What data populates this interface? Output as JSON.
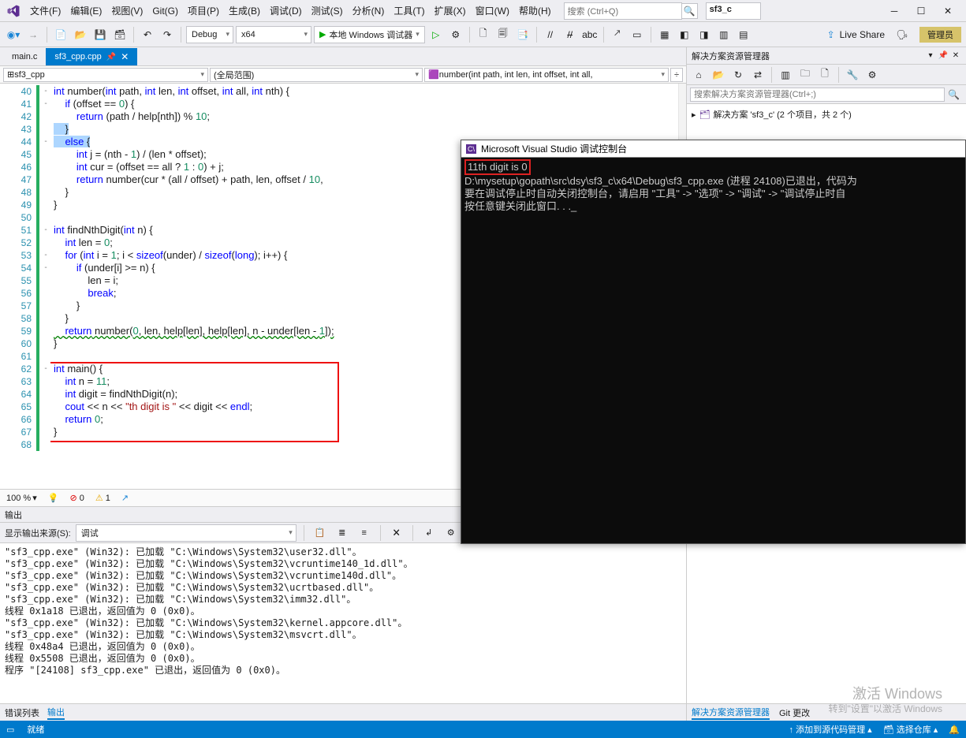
{
  "menubar": {
    "items": [
      "文件(F)",
      "编辑(E)",
      "视图(V)",
      "Git(G)",
      "项目(P)",
      "生成(B)",
      "调试(D)",
      "测试(S)",
      "分析(N)",
      "工具(T)",
      "扩展(X)",
      "窗口(W)",
      "帮助(H)"
    ],
    "search_placeholder": "搜索 (Ctrl+Q)",
    "project_name": "sf3_c"
  },
  "toolbar": {
    "config": "Debug",
    "platform": "x64",
    "run_label": "本地 Windows 调试器",
    "live_share": "Live Share",
    "admin": "管理员"
  },
  "tabs": [
    {
      "label": "main.c",
      "active": false
    },
    {
      "label": "sf3_cpp.cpp",
      "active": true
    }
  ],
  "nav": {
    "scope": "sf3_cpp",
    "scope2": "(全局范围)",
    "member": "number(int path, int len, int offset, int all,"
  },
  "code": {
    "first_line": 40,
    "lines": [
      {
        "n": 40,
        "fold": "-",
        "t": "int number(int path, int len, int offset, int all, int nth) {"
      },
      {
        "n": 41,
        "fold": "-",
        "t": "    if (offset == 0) {"
      },
      {
        "n": 42,
        "t": "        return (path / help[nth]) % 10;"
      },
      {
        "n": 43,
        "t": "    }",
        "sel": true,
        "selText": "    }"
      },
      {
        "n": 44,
        "fold": "-",
        "t": "    else {",
        "sel": true,
        "selText": "    else {"
      },
      {
        "n": 45,
        "t": "        int j = (nth - 1) / (len * offset);"
      },
      {
        "n": 46,
        "t": "        int cur = (offset == all ? 1 : 0) + j;"
      },
      {
        "n": 47,
        "t": "        return number(cur * (all / offset) + path, len, offset / 10,"
      },
      {
        "n": 48,
        "t": "    }"
      },
      {
        "n": 49,
        "t": "}"
      },
      {
        "n": 50,
        "t": ""
      },
      {
        "n": 51,
        "fold": "-",
        "t": "int findNthDigit(int n) {"
      },
      {
        "n": 52,
        "t": "    int len = 0;"
      },
      {
        "n": 53,
        "fold": "-",
        "t": "    for (int i = 1; i < sizeof(under) / sizeof(long); i++) {"
      },
      {
        "n": 54,
        "fold": "-",
        "t": "        if (under[i] >= n) {"
      },
      {
        "n": 55,
        "t": "            len = i;"
      },
      {
        "n": 56,
        "t": "            break;"
      },
      {
        "n": 57,
        "t": "        }"
      },
      {
        "n": 58,
        "t": "    }"
      },
      {
        "n": 59,
        "t": "    return number(0, len, help[len], help[len], n - under[len - 1]);",
        "sq": true
      },
      {
        "n": 60,
        "t": "}"
      },
      {
        "n": 61,
        "t": ""
      },
      {
        "n": 62,
        "fold": "-",
        "t": "int main() {"
      },
      {
        "n": 63,
        "t": "    int n = 11;"
      },
      {
        "n": 64,
        "t": "    int digit = findNthDigit(n);"
      },
      {
        "n": 65,
        "t": "    cout << n << \"th digit is \" << digit << endl;"
      },
      {
        "n": 66,
        "t": "    return 0;"
      },
      {
        "n": 67,
        "t": "}"
      },
      {
        "n": 68,
        "t": ""
      }
    ]
  },
  "diag": {
    "zoom": "100 %",
    "errors": "0",
    "warnings": "1",
    "msgs": ""
  },
  "output": {
    "title": "输出",
    "src_label": "显示输出来源(S):",
    "src_value": "调试",
    "lines": [
      "\"sf3_cpp.exe\" (Win32): 已加载 \"C:\\Windows\\System32\\user32.dll\"。",
      "\"sf3_cpp.exe\" (Win32): 已加载 \"C:\\Windows\\System32\\vcruntime140_1d.dll\"。",
      "\"sf3_cpp.exe\" (Win32): 已加载 \"C:\\Windows\\System32\\vcruntime140d.dll\"。",
      "\"sf3_cpp.exe\" (Win32): 已加载 \"C:\\Windows\\System32\\ucrtbased.dll\"。",
      "\"sf3_cpp.exe\" (Win32): 已加载 \"C:\\Windows\\System32\\imm32.dll\"。",
      "线程 0x1a18 已退出，返回值为 0 (0x0)。",
      "\"sf3_cpp.exe\" (Win32): 已加载 \"C:\\Windows\\System32\\kernel.appcore.dll\"。",
      "\"sf3_cpp.exe\" (Win32): 已加载 \"C:\\Windows\\System32\\msvcrt.dll\"。",
      "线程 0x48a4 已退出，返回值为 0 (0x0)。",
      "线程 0x5508 已退出，返回值为 0 (0x0)。",
      "程序 \"[24108] sf3_cpp.exe\" 已退出，返回值为 0 (0x0)。"
    ]
  },
  "bottom_tabs": {
    "error": "错误列表",
    "output": "输出"
  },
  "solution": {
    "title": "解决方案资源管理器",
    "search_placeholder": "搜索解决方案资源管理器(Ctrl+;)",
    "root": "解决方案 'sf3_c' (2 个项目，共 2 个)",
    "footer_tabs": [
      "解决方案资源管理器",
      "Git 更改"
    ]
  },
  "console": {
    "title": "Microsoft Visual Studio 调试控制台",
    "out_line": "11th digit is 0",
    "body": "\nD:\\mysetup\\gopath\\src\\dsy\\sf3_c\\x64\\Debug\\sf3_cpp.exe (进程 24108)已退出，代码为\n要在调试停止时自动关闭控制台，请启用 \"工具\" -> \"选项\" -> \"调试\" -> \"调试停止时自\n按任意键关闭此窗口. . ._"
  },
  "statusbar": {
    "ready": "就绪",
    "add_src": "添加到源代码管理",
    "select_repo": "选择仓库"
  },
  "watermark": {
    "l1": "激活 Windows",
    "l2": "转到\"设置\"以激活 Windows"
  }
}
